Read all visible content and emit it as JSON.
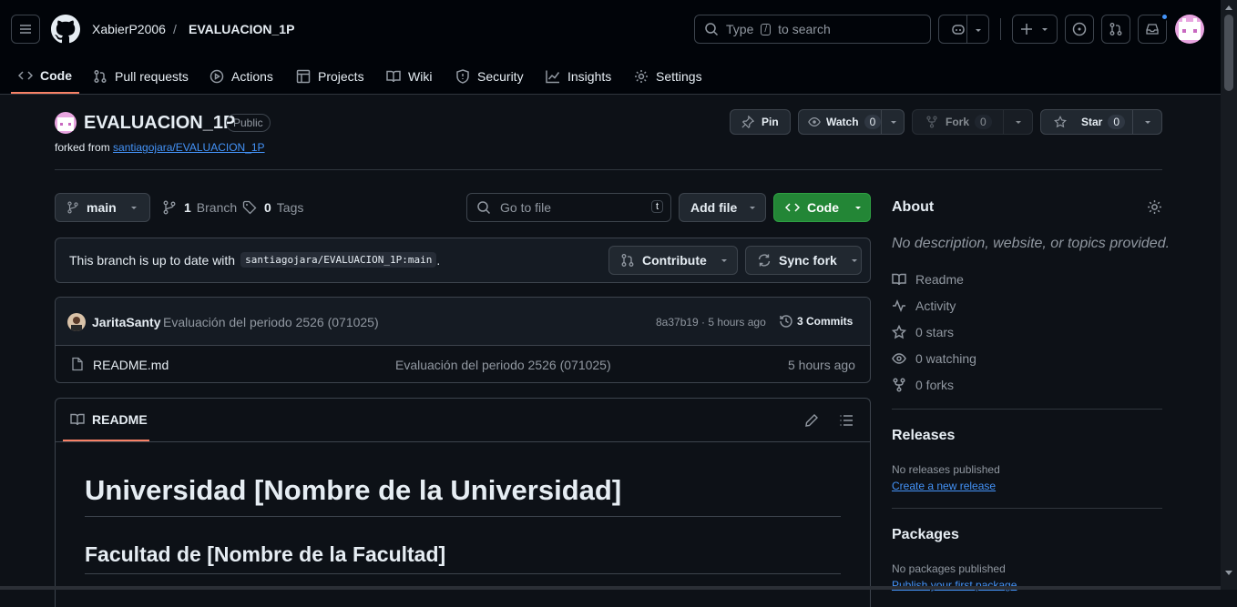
{
  "header": {
    "owner": "XabierP2006",
    "separator": "/",
    "repo": "EVALUACION_1P",
    "search_before": "Type",
    "search_key": "/",
    "search_after": "to search"
  },
  "tabs": [
    {
      "label": "Code",
      "icon": "code-icon",
      "selected": true
    },
    {
      "label": "Pull requests",
      "icon": "pull-request-icon"
    },
    {
      "label": "Actions",
      "icon": "play-icon"
    },
    {
      "label": "Projects",
      "icon": "table-icon"
    },
    {
      "label": "Wiki",
      "icon": "book-icon"
    },
    {
      "label": "Security",
      "icon": "shield-icon"
    },
    {
      "label": "Insights",
      "icon": "graph-icon"
    },
    {
      "label": "Settings",
      "icon": "gear-icon"
    }
  ],
  "repo": {
    "name": "EVALUACION_1P",
    "visibility": "Public",
    "forked_prefix": "forked from",
    "forked_from": "santiagojara/EVALUACION_1P",
    "pin": "Pin",
    "watch": "Watch",
    "watch_count": "0",
    "fork": "Fork",
    "fork_count": "0",
    "star": "Star",
    "star_count": "0"
  },
  "toolbar": {
    "branch": "main",
    "branches_count": "1",
    "branches_label": "Branch",
    "tags_count": "0",
    "tags_label": "Tags",
    "goto_placeholder": "Go to file",
    "goto_key": "t",
    "add_file": "Add file",
    "code": "Code"
  },
  "sync": {
    "text": "This branch is up to date with",
    "ref": "santiagojara/EVALUACION_1P:main",
    "period": ".",
    "contribute": "Contribute",
    "sync_fork": "Sync fork"
  },
  "commit": {
    "author": "JaritaSanty",
    "message": "Evaluación del periodo 2526 (071025)",
    "hash_time": "8a37b19 · 5 hours ago",
    "commits": "3 Commits"
  },
  "files": [
    {
      "name": "README.md",
      "message": "Evaluación del periodo 2526 (071025)",
      "time": "5 hours ago"
    }
  ],
  "readme": {
    "tab": "README",
    "h1": "Universidad [Nombre de la Universidad]",
    "h2": "Facultad de [Nombre de la Facultad]"
  },
  "about": {
    "title": "About",
    "description": "No description, website, or topics provided.",
    "readme": "Readme",
    "activity": "Activity",
    "stars": "0 stars",
    "watching": "0 watching",
    "forks": "0 forks",
    "releases_title": "Releases",
    "releases_text": "No releases published",
    "releases_link": "Create a new release",
    "packages_title": "Packages",
    "packages_text": "No packages published",
    "packages_link": "Publish your first package"
  },
  "colors": {
    "accent": "#f78166",
    "green": "#238636",
    "link": "#4493f8",
    "bg": "#0d1117"
  }
}
